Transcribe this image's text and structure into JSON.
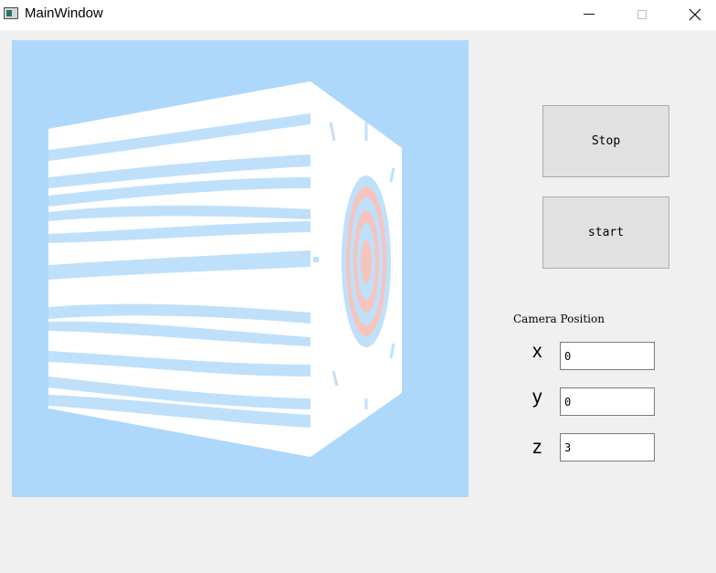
{
  "window": {
    "title": "MainWindow",
    "controls": [
      "minimize-icon",
      "maximize-icon",
      "close-icon"
    ]
  },
  "viewport": {
    "background": "#add8fb",
    "object": "textured cube (light-blue stripes on sides, concentric ring target on front face)"
  },
  "buttons": {
    "stop_label": "Stop",
    "start_label": "start"
  },
  "camera": {
    "group_label": "Camera Position",
    "x_label": "x",
    "y_label": "y",
    "z_label": "z",
    "x_value": "0",
    "y_value": "0",
    "z_value": "3"
  },
  "colors": {
    "window_bg": "#f0f0f0",
    "titlebar_bg": "#ffffff",
    "button_bg": "#e1e1e1",
    "stripe_blue": "#bfe0fb",
    "ring_pink": "#f6c4bd"
  }
}
